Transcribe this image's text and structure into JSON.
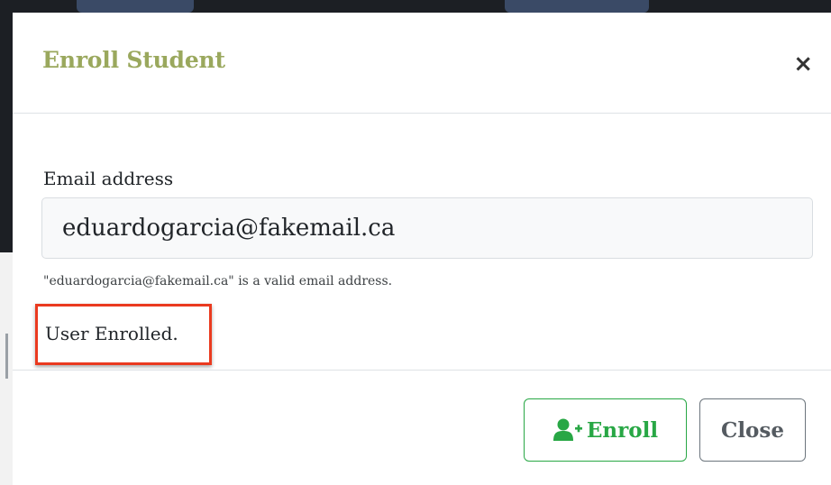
{
  "modal": {
    "title": "Enroll Student",
    "close_symbol": "×"
  },
  "form": {
    "email_label": "Email address",
    "email_value": "eduardogarcia@fakemail.ca",
    "help_text": "\"eduardogarcia@fakemail.ca\" is a valid email address.",
    "status_message": "User Enrolled."
  },
  "footer": {
    "enroll_label": "Enroll",
    "enroll_icon": "user-plus-icon",
    "close_label": "Close"
  },
  "colors": {
    "title": "#9aa85d",
    "success": "#28a745",
    "secondary": "#6c757d",
    "highlight": "#ea3a1f"
  }
}
